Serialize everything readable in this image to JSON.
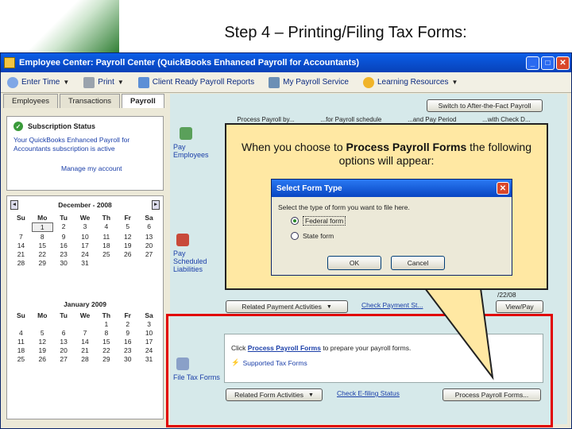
{
  "slide": {
    "title": "Step 4 – Printing/Filing Tax Forms:"
  },
  "window": {
    "title": "Employee Center: Payroll Center (QuickBooks Enhanced Payroll for Accountants)",
    "controls": {
      "minimize": "_",
      "maximize": "□",
      "close": "✕"
    }
  },
  "toolbar": {
    "items": [
      {
        "label": "Enter Time",
        "icon": "clock-icon",
        "dropdown": true
      },
      {
        "label": "Print",
        "icon": "printer-icon",
        "dropdown": true
      },
      {
        "label": "Client Ready Payroll Reports",
        "icon": "report-icon",
        "dropdown": false
      },
      {
        "label": "My Payroll Service",
        "icon": "person-icon",
        "dropdown": false
      },
      {
        "label": "Learning Resources",
        "icon": "help-icon",
        "dropdown": true
      }
    ]
  },
  "tabs": [
    "Employees",
    "Transactions",
    "Payroll"
  ],
  "subscription": {
    "title": "Subscription Status",
    "text": "Your QuickBooks Enhanced Payroll for Accountants subscription is active",
    "manage_link": "Manage my account"
  },
  "calendar": {
    "dec_title": "December - 2008",
    "jan_title": "January 2009",
    "day_headers": [
      "Su",
      "Mo",
      "Tu",
      "We",
      "Th",
      "Fr",
      "Sa"
    ],
    "dec_rows": [
      [
        "",
        "1",
        "2",
        "3",
        "4",
        "5",
        "6"
      ],
      [
        "7",
        "8",
        "9",
        "10",
        "11",
        "12",
        "13"
      ],
      [
        "14",
        "15",
        "16",
        "17",
        "18",
        "19",
        "20"
      ],
      [
        "21",
        "22",
        "23",
        "24",
        "25",
        "26",
        "27"
      ],
      [
        "28",
        "29",
        "30",
        "31",
        "",
        "",
        ""
      ]
    ],
    "jan_rows": [
      [
        "",
        "",
        "",
        "",
        "1",
        "2",
        "3"
      ],
      [
        "4",
        "5",
        "6",
        "7",
        "8",
        "9",
        "10"
      ],
      [
        "11",
        "12",
        "13",
        "14",
        "15",
        "16",
        "17"
      ],
      [
        "18",
        "19",
        "20",
        "21",
        "22",
        "23",
        "24"
      ],
      [
        "25",
        "26",
        "27",
        "28",
        "29",
        "30",
        "31"
      ]
    ]
  },
  "sections": {
    "pay_employees": "Pay Employees",
    "pay_liabilities": "Pay Scheduled Liabilities",
    "file_tax_forms": "File Tax Forms"
  },
  "main": {
    "after_fact_btn": "Switch to After-the-Fact Payroll",
    "header_cells": [
      "Process Payroll by...",
      "...for Payroll schedule",
      "...and Pay Period",
      "...with Check D..."
    ],
    "related_payment_btn": "Related Payment Activities",
    "check_payment_link": "Check Payment St...",
    "view_pay_btn": "View/Pay",
    "date_fragment": "/22/08",
    "click_prefix": "Click",
    "process_link": "Process Payroll Forms",
    "click_suffix": "to prepare your payroll forms.",
    "supported_link": "Supported Tax Forms",
    "related_form_btn": "Related Form Activities",
    "check_efiling_link": "Check E-filing Status",
    "process_btn": "Process Payroll Forms..."
  },
  "callout": {
    "text_before": "When you choose to ",
    "text_bold": "Process Payroll Forms",
    "text_after": " the following options will appear:"
  },
  "dialog": {
    "title": "Select Form Type",
    "prompt": "Select the type of form you want to file here.",
    "option1": "Federal form",
    "option2": "State form",
    "ok": "OK",
    "cancel": "Cancel"
  }
}
